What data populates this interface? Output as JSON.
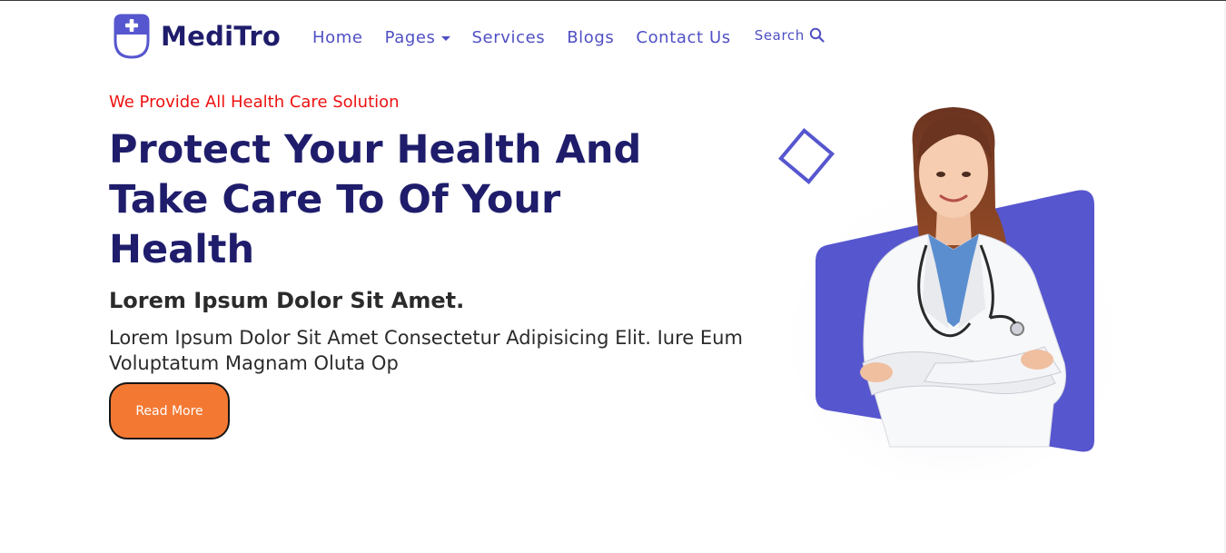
{
  "brand": {
    "name": "MediTro",
    "logo_icon": "plus-shield-icon",
    "color": "#1f1d6b"
  },
  "nav": {
    "items": [
      {
        "label": "Home"
      },
      {
        "label": "Pages",
        "has_dropdown": true
      },
      {
        "label": "Services"
      },
      {
        "label": "Blogs"
      },
      {
        "label": "Contact Us"
      }
    ],
    "search_label": "Search",
    "search_icon": "magnifier-icon",
    "link_color": "#4f4fc4"
  },
  "hero": {
    "tagline": "We Provide All Health Care Solution",
    "headline": "Protect Your Health And Take Care To Of Your Health",
    "subheading": "Lorem Ipsum Dolor Sit Amet.",
    "body": "Lorem Ipsum Dolor Sit Amet Consectetur Adipisicing Elit. Iure Eum Voluptatum Magnam Oluta Op",
    "cta_label": "Read More",
    "tagline_color": "#ee1111",
    "cta_color": "#f37832",
    "accent_color": "#5656cf",
    "image": "doctor-portrait"
  }
}
